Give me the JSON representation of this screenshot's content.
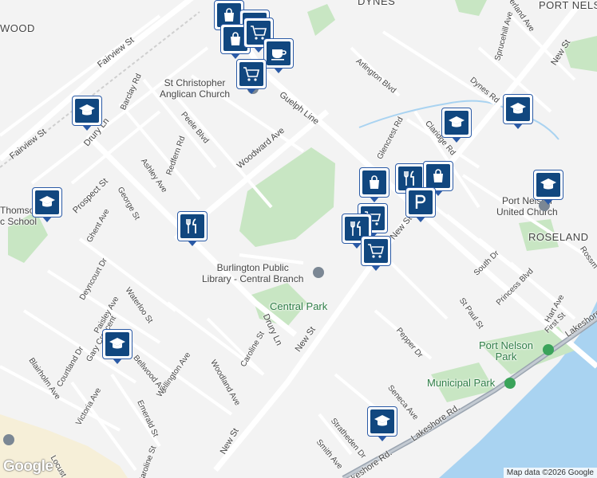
{
  "map": {
    "labels": {
      "port_nelson_top": "PORT NELS",
      "dynes_top": "DYNES",
      "elwood": "WOOD",
      "fairview_st": "Fairview St",
      "fairview_st_2": "Fairview St",
      "barclay_rd": "Barclay Rd",
      "drury_ln": "Drury Ln",
      "drury_ln_2": "Drury Ln",
      "peele_blvd": "Peele Blvd",
      "redfern_rd": "Redfern Rd",
      "ashley_ave": "Ashley Ave",
      "woodward_ave": "Woodward Ave",
      "guelph_line": "Guelph Line",
      "prospect_st": "Prospect St",
      "george_st": "George St",
      "ghent_ave": "Ghent Ave",
      "deyncourt_dr": "Deyncourt Dr",
      "paisley_ave": "Paisley Ave",
      "waterloo_st": "Waterloo St",
      "gary_crescent": "Gary Crescent",
      "courtland_dr": "Courtland Dr",
      "blairholm_ave": "Blairholm Ave",
      "bellwood_ave": "Bellwood Ave",
      "wellington_ave": "Wellington Ave",
      "victoria_ave": "Victoria Ave",
      "emerald_st": "Emerald St",
      "caroline_st": "Caroline St",
      "woodland_ave": "Woodland Ave",
      "caroline_st_2": "Caroline St",
      "locust": "Locust",
      "new_st_1": "New St",
      "new_st_2": "New St",
      "new_st_3": "New St",
      "new_st_4": "New St",
      "arlington_blvd": "Arlington Blvd",
      "glencrest_rd": "Glencrest Rd",
      "claridge_rd": "Claridge Rd",
      "dynes_rd": "Dynes Rd",
      "sprucehill_ave": "Sprucehill Ave",
      "sutherland_ave": "erland Ave",
      "south_dr": "South Dr",
      "princess_blvd": "Princess Blvd",
      "st_paul_st": "St Paul St",
      "hart_ave": "Hart Ave",
      "first_st": "First St",
      "rossmore": "Rossm",
      "pepper_dr": "Pepper Dr",
      "seneca_ave": "Seneca Ave",
      "stratheden_dr": "Stratheden Dr",
      "smith_ave": "Smith Ave",
      "lakeshore_rd": "Lakeshore Rd.",
      "lakeshore_rd_2": "Lakeshore Rd.",
      "lakeshore_2": "Lakeshore",
      "roseland": "ROSELAND",
      "st_christopher": "St Christopher\nAnglican Church",
      "port_nelson_church": "Port Nelson\nUnited Church",
      "library": "Burlington Public\nLibrary - Central Branch",
      "central_park": "Central Park",
      "port_nelson_park": "Port Nelson\nPark",
      "municipal_park": "Municipal Park",
      "thomson_school": "Thomso\nc School"
    },
    "markers": [
      {
        "type": "shopping-bag"
      },
      {
        "type": "shopping-cart"
      },
      {
        "type": "shopping-bag"
      },
      {
        "type": "shopping-cart"
      },
      {
        "type": "coffee"
      },
      {
        "type": "shopping-cart"
      },
      {
        "type": "school"
      },
      {
        "type": "school"
      },
      {
        "type": "restaurant"
      },
      {
        "type": "school"
      },
      {
        "type": "school"
      },
      {
        "type": "school"
      },
      {
        "type": "school"
      },
      {
        "type": "shopping-bag"
      },
      {
        "type": "restaurant"
      },
      {
        "type": "shopping-bag"
      },
      {
        "type": "parking"
      },
      {
        "type": "shopping-cart"
      },
      {
        "type": "restaurant"
      },
      {
        "type": "shopping-cart"
      },
      {
        "type": "school"
      }
    ],
    "colors": {
      "background": "#f3f3f3",
      "park": "#c8e6c3",
      "water": "#a9d3f1",
      "road": "#ffffff",
      "highway": "#9aa4b0",
      "marker": "#11477f"
    }
  },
  "attribution": {
    "google_logo": "Google",
    "map_data": "Map data ©2026 Google"
  }
}
